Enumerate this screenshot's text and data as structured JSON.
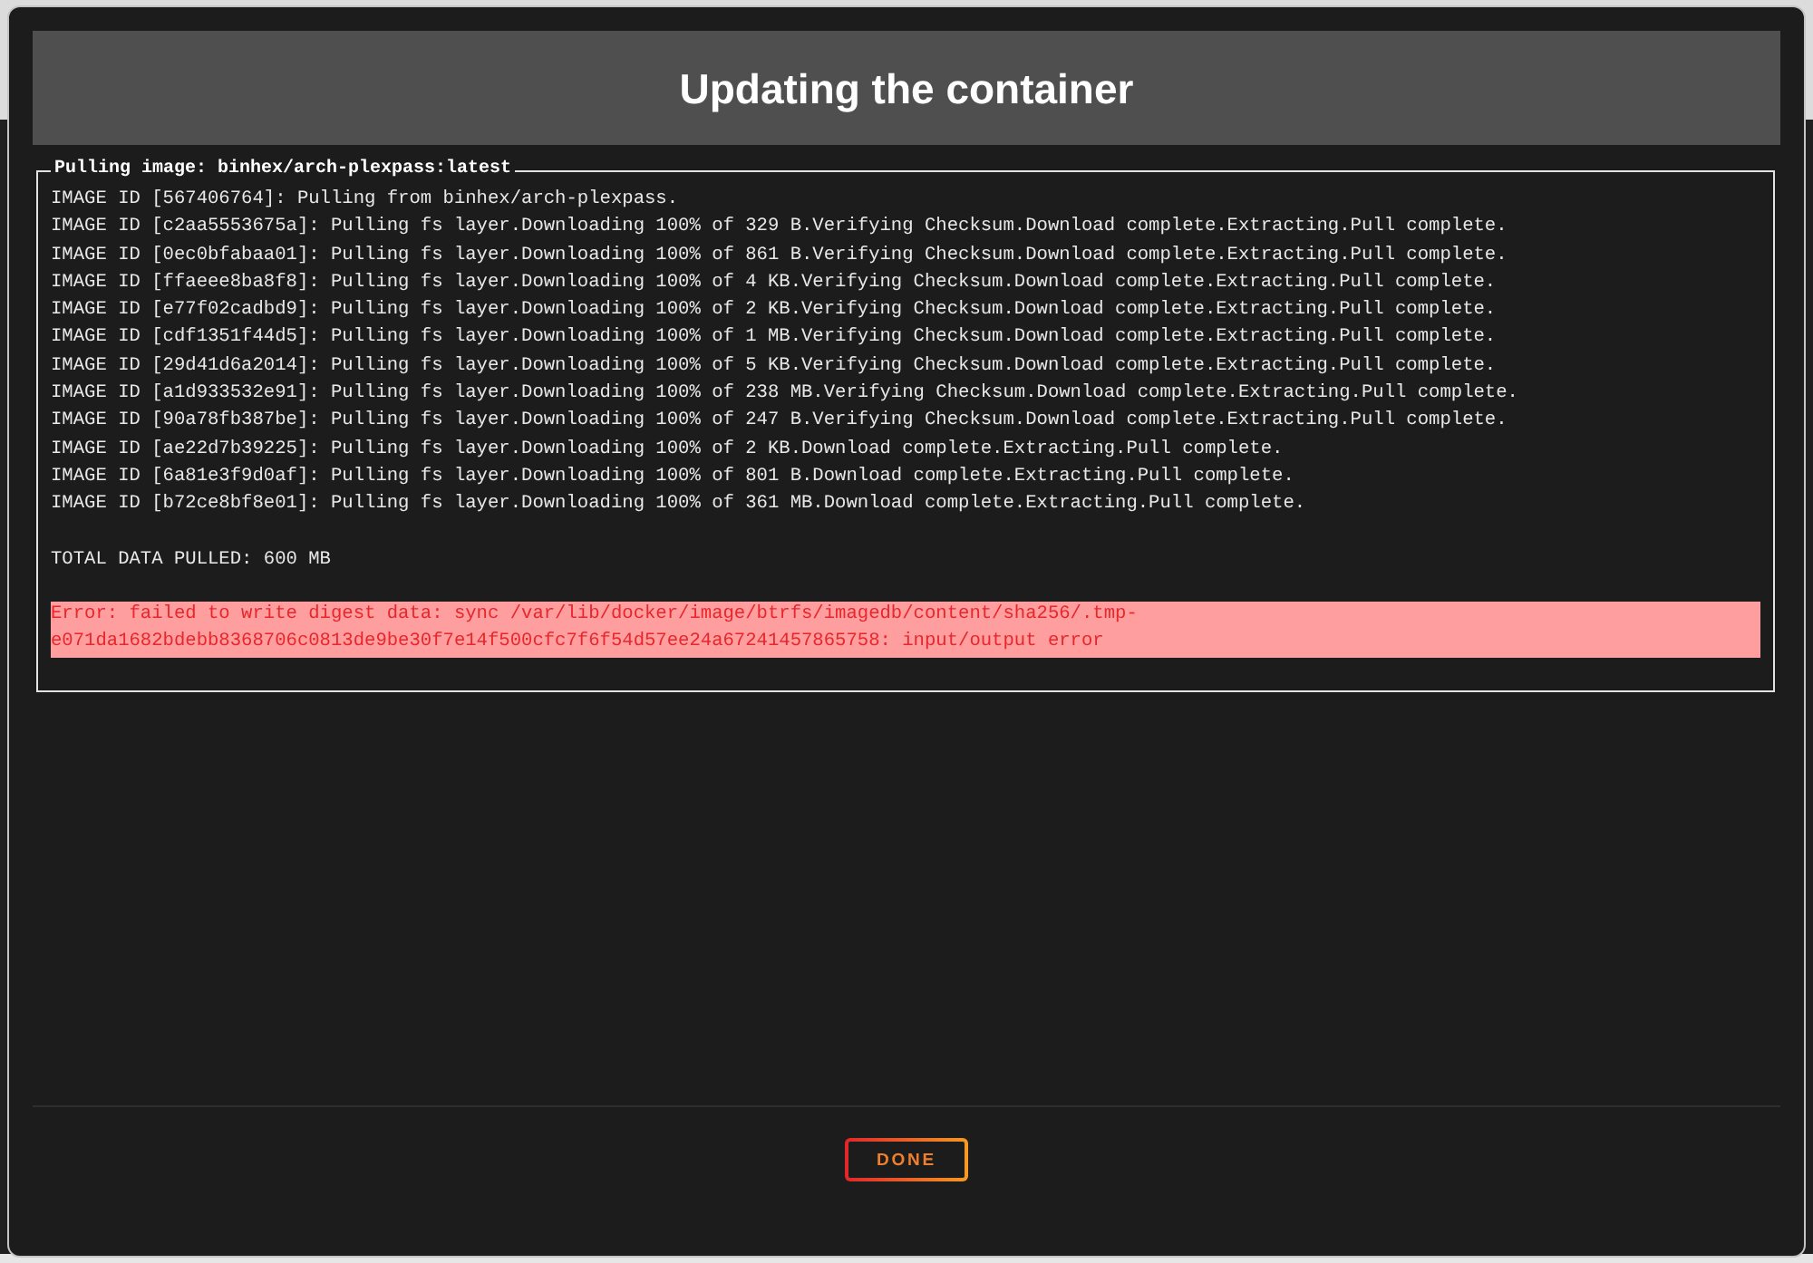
{
  "dialog": {
    "title": "Updating the container"
  },
  "log": {
    "legend": "Pulling image: binhex/arch-plexpass:latest",
    "lines": [
      "IMAGE ID [567406764]: Pulling from binhex/arch-plexpass.",
      "IMAGE ID [c2aa5553675a]: Pulling fs layer.Downloading 100% of 329 B.Verifying Checksum.Download complete.Extracting.Pull complete.",
      "IMAGE ID [0ec0bfabaa01]: Pulling fs layer.Downloading 100% of 861 B.Verifying Checksum.Download complete.Extracting.Pull complete.",
      "IMAGE ID [ffaeee8ba8f8]: Pulling fs layer.Downloading 100% of 4 KB.Verifying Checksum.Download complete.Extracting.Pull complete.",
      "IMAGE ID [e77f02cadbd9]: Pulling fs layer.Downloading 100% of 2 KB.Verifying Checksum.Download complete.Extracting.Pull complete.",
      "IMAGE ID [cdf1351f44d5]: Pulling fs layer.Downloading 100% of 1 MB.Verifying Checksum.Download complete.Extracting.Pull complete.",
      "IMAGE ID [29d41d6a2014]: Pulling fs layer.Downloading 100% of 5 KB.Verifying Checksum.Download complete.Extracting.Pull complete.",
      "IMAGE ID [a1d933532e91]: Pulling fs layer.Downloading 100% of 238 MB.Verifying Checksum.Download complete.Extracting.Pull complete.",
      "IMAGE ID [90a78fb387be]: Pulling fs layer.Downloading 100% of 247 B.Verifying Checksum.Download complete.Extracting.Pull complete.",
      "IMAGE ID [ae22d7b39225]: Pulling fs layer.Downloading 100% of 2 KB.Download complete.Extracting.Pull complete.",
      "IMAGE ID [6a81e3f9d0af]: Pulling fs layer.Downloading 100% of 801 B.Download complete.Extracting.Pull complete.",
      "IMAGE ID [b72ce8bf8e01]: Pulling fs layer.Downloading 100% of 361 MB.Download complete.Extracting.Pull complete."
    ],
    "total": "TOTAL DATA PULLED: 600 MB",
    "error": "Error: failed to write digest data: sync /var/lib/docker/image/btrfs/imagedb/content/sha256/.tmp-e071da1682bdebb8368706c0813de9be30f7e14f500cfc7f6f54d57ee24a67241457865758: input/output error"
  },
  "buttons": [
    {
      "label": "DONE"
    }
  ]
}
